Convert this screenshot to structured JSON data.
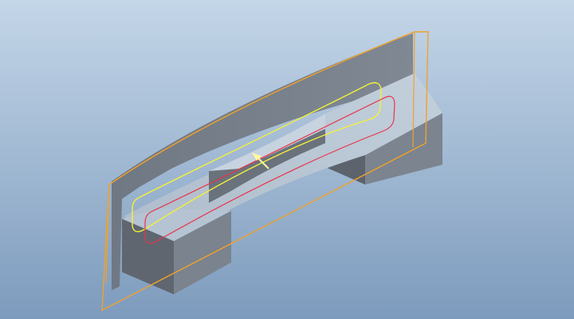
{
  "viewport": {
    "background_top": "#c4d6e8",
    "background_bottom": "#7d9bbd"
  },
  "model": {
    "colors": {
      "face_light": "#b9c7d6",
      "face_mid": "#7c8591",
      "face_dark": "#5f6771",
      "face_side": "#8e98a4",
      "edge": "#55606c"
    }
  },
  "datum_plane": {
    "color": "#f2a12a"
  },
  "sketch": {
    "outer_color": "#f4f03a",
    "inner_color": "#e8344a"
  },
  "direction_arrow": {
    "color": "#fff7a0"
  }
}
